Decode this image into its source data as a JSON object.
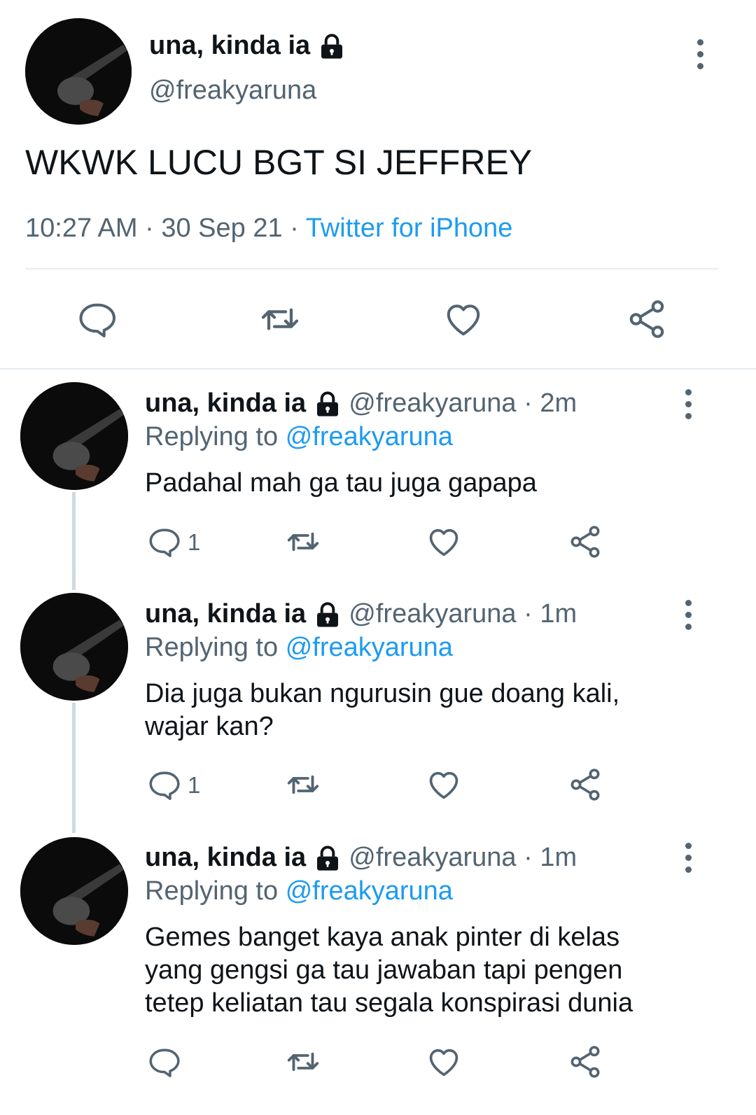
{
  "main_tweet": {
    "display_name": "una, kinda ia",
    "handle": "@freakyaruna",
    "text": "WKWK LUCU BGT SI JEFFREY",
    "time": "10:27 AM",
    "date": "30 Sep 21",
    "separator": "·",
    "source": "Twitter for iPhone"
  },
  "replies": [
    {
      "display_name": "una, kinda ia",
      "handle": "@freakyaruna",
      "separator": "·",
      "age": "2m",
      "replying_label": "Replying to",
      "replying_to": "@freakyaruna",
      "text_lines": [
        "Padahal mah ga tau juga gapapa"
      ],
      "reply_count": "1"
    },
    {
      "display_name": "una, kinda ia",
      "handle": "@freakyaruna",
      "separator": "·",
      "age": "1m",
      "replying_label": "Replying to",
      "replying_to": "@freakyaruna",
      "text_lines": [
        "Dia juga bukan ngurusin gue doang kali,",
        "wajar kan?"
      ],
      "reply_count": "1"
    },
    {
      "display_name": "una, kinda ia",
      "handle": "@freakyaruna",
      "separator": "·",
      "age": "1m",
      "replying_label": "Replying to",
      "replying_to": "@freakyaruna",
      "text_lines": [
        "Gemes banget kaya anak pinter di kelas",
        "yang gengsi ga tau jawaban tapi pengen",
        "tetep keliatan tau segala konspirasi dunia"
      ],
      "reply_count": ""
    }
  ],
  "icons": {
    "lock": "lock-icon",
    "reply": "reply-icon",
    "retweet": "retweet-icon",
    "like": "like-icon",
    "share": "share-icon",
    "more": "more-vertical-icon",
    "avatar": "guitar-avatar"
  },
  "colors": {
    "text": "#0f1419",
    "secondary": "#536471",
    "link": "#1d9bf0",
    "divider": "#e6ecf0",
    "thread_line": "#cfd9de"
  }
}
